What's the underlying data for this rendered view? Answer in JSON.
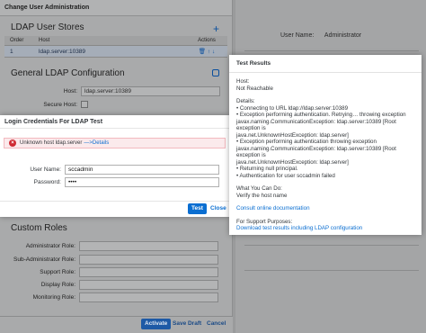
{
  "background": {
    "user_label": "User Name:",
    "user_value": "Administrator"
  },
  "dialog": {
    "title": "Change User Administration",
    "ldap_stores_title": "LDAP User Stores",
    "table": {
      "headers": [
        "Order",
        "Host",
        "Actions"
      ],
      "rows": [
        {
          "order": "1",
          "host": "ldap.server:10389"
        }
      ]
    },
    "general_title": "General LDAP Configuration",
    "host_label": "Host:",
    "host_value": "ldap.server:10389",
    "secure_host_label": "Secure Host:",
    "custom_roles_title": "Custom Roles",
    "roles": [
      "Administrator Role:",
      "Sub-Administrator Role:",
      "Support Role:",
      "Display Role:",
      "Monitoring Role:"
    ],
    "footer": {
      "activate": "Activate",
      "save_draft": "Save Draft",
      "cancel": "Cancel"
    }
  },
  "login": {
    "title": "Login Credentials For LDAP Test",
    "error_text": "Unknown host ldap.server",
    "details_link": "—>Details",
    "user_label": "User Name:",
    "user_value": "sccadmin",
    "password_label": "Password:",
    "password_value": "••••",
    "test_button": "Test",
    "close_button": "Close"
  },
  "results": {
    "title": "Test Results",
    "host_label": "Host:",
    "host_status": "Not Reachable",
    "details_label": "Details:",
    "details": [
      "• Connecting to URL ldap://ldap.server:10389",
      "• Exception performing authentication. Retrying… throwing exception",
      "javax.naming.CommunicationException: ldap.server:10389 [Root exception is",
      "java.net.UnknownHostException: ldap.server]",
      "• Exception performing authentication throwing exception",
      "javax.naming.CommunicationException: ldap.server:10389 [Root exception is",
      "java.net.UnknownHostException: ldap.server]",
      "• Returning null principal.",
      "• Authentication for user sccadmin failed"
    ],
    "what_label": "What You Can Do:",
    "what_value": "Verify the host name",
    "consult_link": "Consult online documentation",
    "support_label": "For Support Purposes:",
    "download_link": "Download test results including LDAP configuration"
  }
}
